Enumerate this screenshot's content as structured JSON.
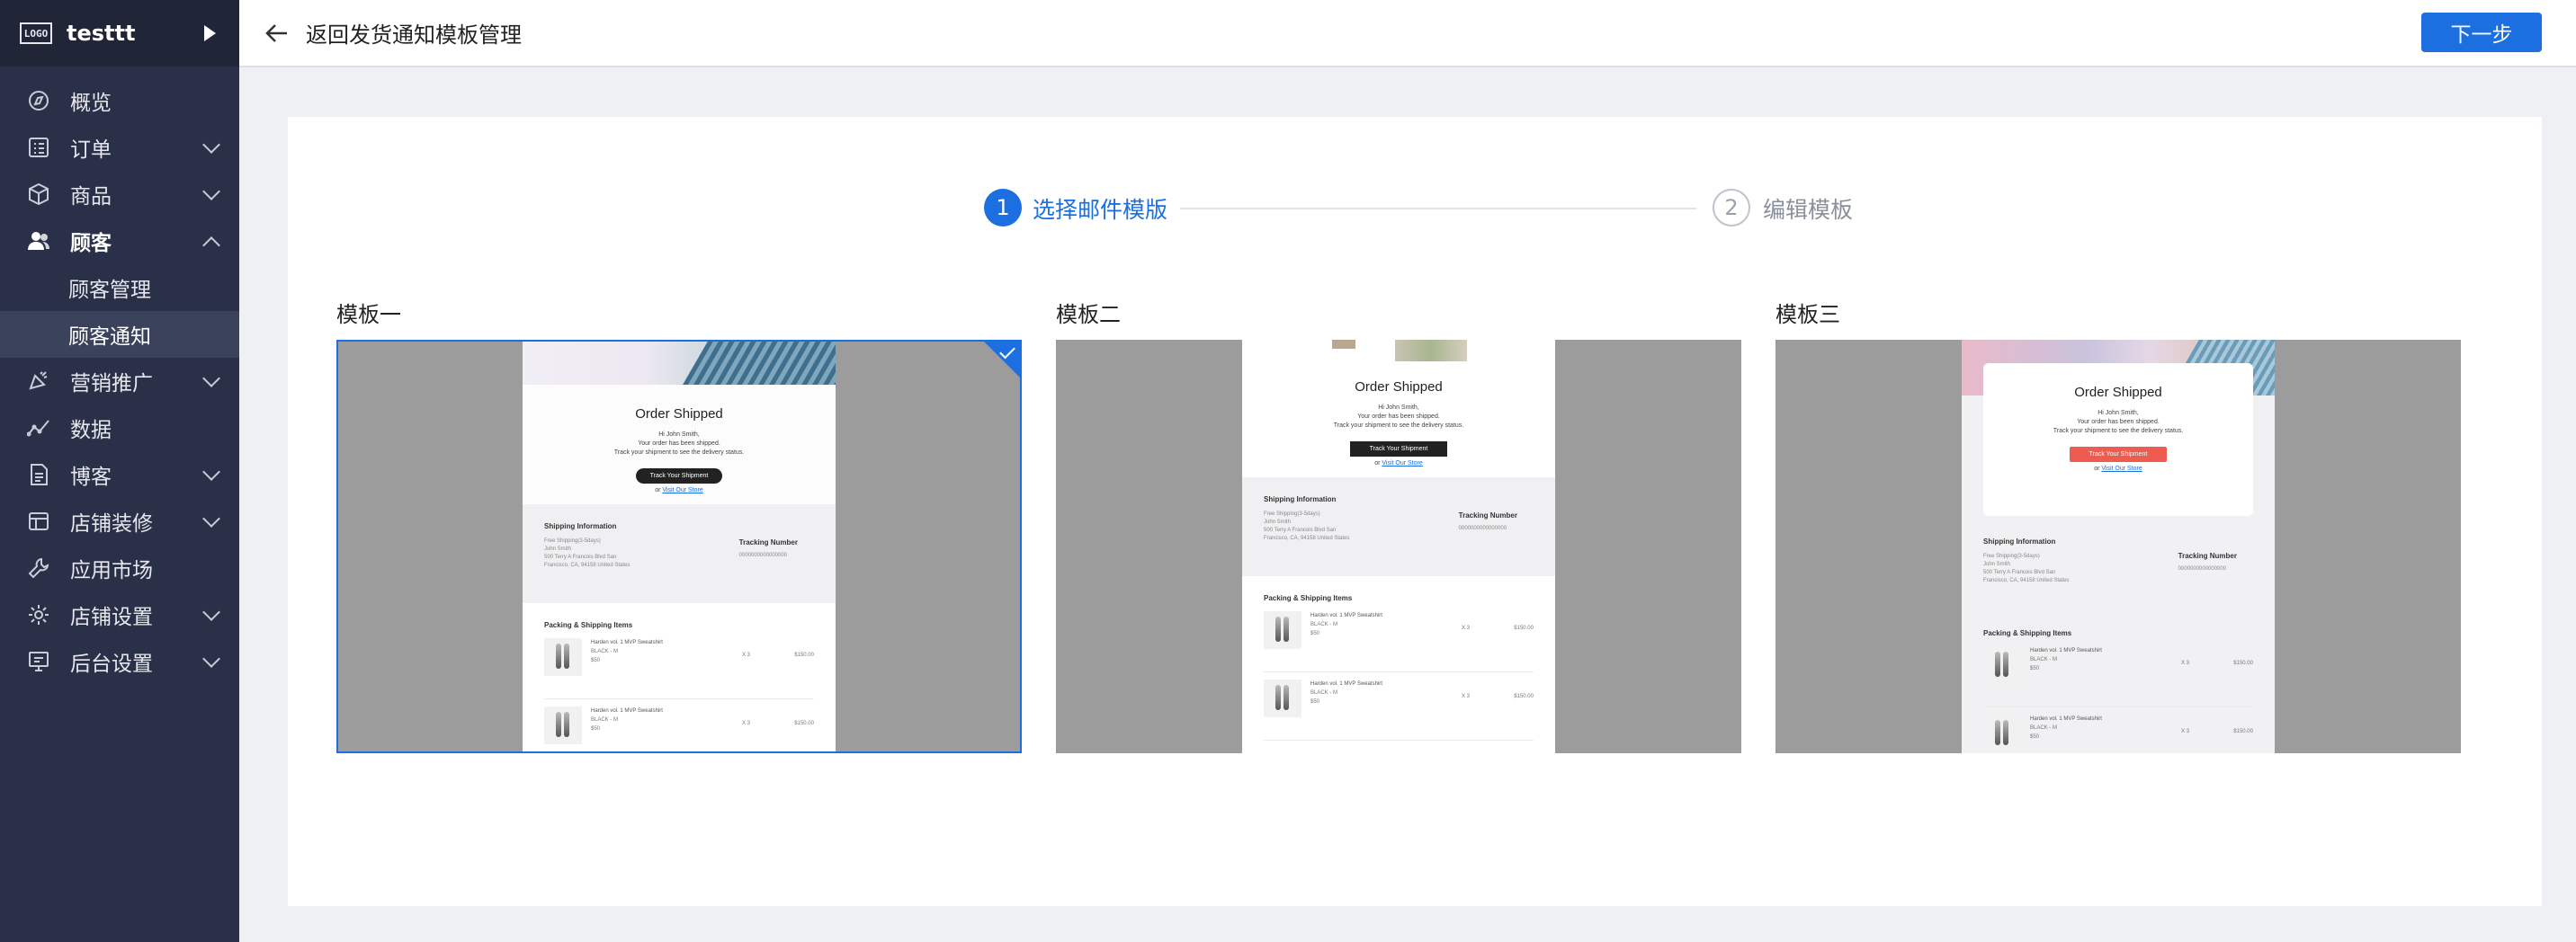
{
  "brand": {
    "logo_text": "LOGO",
    "store_name": "testtt"
  },
  "sidebar": {
    "items": [
      {
        "label": "概览",
        "icon": "dashboard-icon",
        "expandable": false
      },
      {
        "label": "订单",
        "icon": "order-icon",
        "expandable": true
      },
      {
        "label": "商品",
        "icon": "product-icon",
        "expandable": true
      },
      {
        "label": "顾客",
        "icon": "customers-icon",
        "expandable": true,
        "expanded": true,
        "children": [
          {
            "label": "顾客管理"
          },
          {
            "label": "顾客通知",
            "selected": true
          }
        ]
      },
      {
        "label": "营销推广",
        "icon": "marketing-icon",
        "expandable": true
      },
      {
        "label": "数据",
        "icon": "analytics-icon",
        "expandable": false
      },
      {
        "label": "博客",
        "icon": "blog-icon",
        "expandable": true
      },
      {
        "label": "店铺装修",
        "icon": "store-design-icon",
        "expandable": true
      },
      {
        "label": "应用市场",
        "icon": "app-market-icon",
        "expandable": false
      },
      {
        "label": "店铺设置",
        "icon": "store-settings-icon",
        "expandable": true
      },
      {
        "label": "后台设置",
        "icon": "admin-settings-icon",
        "expandable": true
      }
    ]
  },
  "topbar": {
    "back_label": "返回发货通知模板管理",
    "next_label": "下一步"
  },
  "steps": [
    {
      "number": "1",
      "label": "选择邮件模版",
      "active": true
    },
    {
      "number": "2",
      "label": "编辑模板",
      "active": false
    }
  ],
  "templates": [
    {
      "title": "模板一",
      "selected": true
    },
    {
      "title": "模板二",
      "selected": false
    },
    {
      "title": "模板三",
      "selected": false
    }
  ],
  "email_preview": {
    "heading": "Order Shipped",
    "greeting": "Hi John Smith,",
    "line1": "Your order has been shipped.",
    "line2": "Track your shipment to see the delivery status.",
    "track_button": "Track Your Shipment",
    "or": "or",
    "visit": "Visit Our Store",
    "shipping_title": "Shipping Information",
    "shipping_lines": [
      "Free Shipping(3-5days)",
      "John Smith",
      "500 Terry A Francois Blvd San",
      "Francisco,  CA,  94158 United States"
    ],
    "tracking_title": "Tracking Number",
    "tracking_value": "0000000000000000",
    "items_title": "Packing & Shipping Items",
    "items": [
      {
        "name": "Harden vol. 1 MVP Sweatshirt",
        "variant": "BLACK - M",
        "unit": "$50",
        "qty": "X 3",
        "price": "$150.00"
      },
      {
        "name": "Harden vol. 1 MVP Sweatshirt",
        "variant": "BLACK - M",
        "unit": "$50",
        "qty": "X 3",
        "price": "$150.00"
      }
    ]
  },
  "colors": {
    "primary": "#1b6fe0",
    "sidebar_bg": "#2a3048",
    "coral": "#ee5b4f"
  }
}
